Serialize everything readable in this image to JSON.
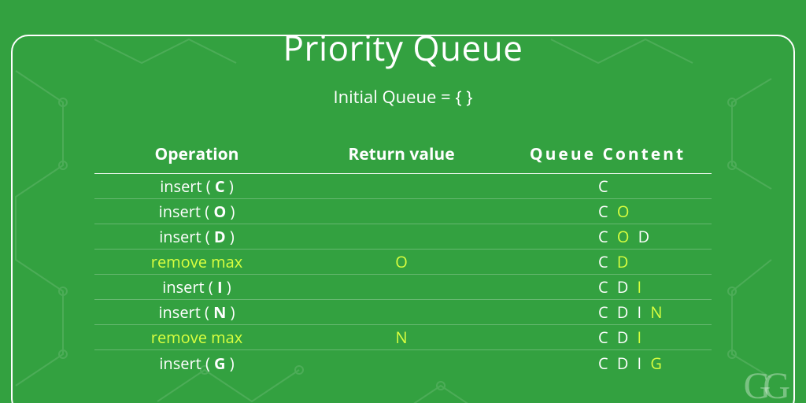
{
  "title": "Priority Queue",
  "subtitle": "Initial Queue = { }",
  "headers": {
    "operation": "Operation",
    "return": "Return value",
    "queue": "Queue Content"
  },
  "rows": [
    {
      "op_prefix": "insert ( ",
      "op_bold": "C",
      "op_suffix": " )",
      "op_hl": false,
      "return": "",
      "return_hl": false,
      "queue": [
        {
          "t": "C",
          "hl": false
        }
      ]
    },
    {
      "op_prefix": "insert ( ",
      "op_bold": "O",
      "op_suffix": " )",
      "op_hl": false,
      "return": "",
      "return_hl": false,
      "queue": [
        {
          "t": "C",
          "hl": false
        },
        {
          "t": " ",
          "hl": false
        },
        {
          "t": "O",
          "hl": true
        }
      ]
    },
    {
      "op_prefix": "insert ( ",
      "op_bold": "D",
      "op_suffix": " )",
      "op_hl": false,
      "return": "",
      "return_hl": false,
      "queue": [
        {
          "t": "C",
          "hl": false
        },
        {
          "t": " ",
          "hl": false
        },
        {
          "t": "O",
          "hl": true
        },
        {
          "t": " ",
          "hl": false
        },
        {
          "t": "D",
          "hl": false
        }
      ]
    },
    {
      "op_prefix": "remove max",
      "op_bold": "",
      "op_suffix": "",
      "op_hl": true,
      "return": "O",
      "return_hl": true,
      "queue": [
        {
          "t": "C",
          "hl": false
        },
        {
          "t": " ",
          "hl": false
        },
        {
          "t": "D",
          "hl": true
        }
      ]
    },
    {
      "op_prefix": "insert ( ",
      "op_bold": "I",
      "op_suffix": " )",
      "op_hl": false,
      "return": "",
      "return_hl": false,
      "queue": [
        {
          "t": "C",
          "hl": false
        },
        {
          "t": " ",
          "hl": false
        },
        {
          "t": "D",
          "hl": false
        },
        {
          "t": " ",
          "hl": false
        },
        {
          "t": "I",
          "hl": true
        }
      ]
    },
    {
      "op_prefix": "insert ( ",
      "op_bold": "N",
      "op_suffix": " )",
      "op_hl": false,
      "return": "",
      "return_hl": false,
      "queue": [
        {
          "t": "C",
          "hl": false
        },
        {
          "t": " ",
          "hl": false
        },
        {
          "t": "D",
          "hl": false
        },
        {
          "t": " ",
          "hl": false
        },
        {
          "t": "I",
          "hl": false
        },
        {
          "t": " ",
          "hl": false
        },
        {
          "t": "N",
          "hl": true
        }
      ]
    },
    {
      "op_prefix": "remove max",
      "op_bold": "",
      "op_suffix": "",
      "op_hl": true,
      "return": "N",
      "return_hl": true,
      "queue": [
        {
          "t": "C",
          "hl": false
        },
        {
          "t": " ",
          "hl": false
        },
        {
          "t": "D",
          "hl": false
        },
        {
          "t": " ",
          "hl": false
        },
        {
          "t": "I",
          "hl": true
        }
      ]
    },
    {
      "op_prefix": "insert ( ",
      "op_bold": "G",
      "op_suffix": " )",
      "op_hl": false,
      "return": "",
      "return_hl": false,
      "queue": [
        {
          "t": "C",
          "hl": false
        },
        {
          "t": " ",
          "hl": false
        },
        {
          "t": "D",
          "hl": false
        },
        {
          "t": " ",
          "hl": false
        },
        {
          "t": "I",
          "hl": false
        },
        {
          "t": " ",
          "hl": false
        },
        {
          "t": "G",
          "hl": true
        }
      ]
    }
  ],
  "logo": "GG",
  "colors": {
    "bg": "#33a140",
    "fg": "#ffffff",
    "highlight": "#d9ff3f"
  }
}
